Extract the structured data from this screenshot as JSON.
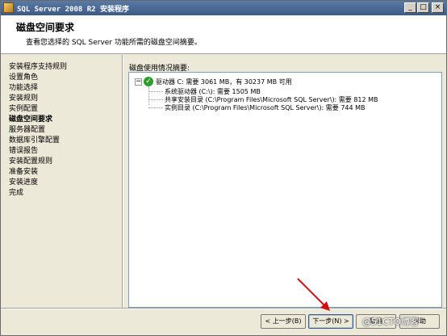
{
  "window": {
    "title": "SQL Server 2008 R2 安装程序",
    "minimize_label": "_",
    "maximize_label": "□",
    "close_label": "×"
  },
  "header": {
    "title": "磁盘空间要求",
    "description": "查看您选择的 SQL Server 功能所需的磁盘空间摘要。"
  },
  "sidebar": {
    "items": [
      {
        "label": "安装程序支持规则"
      },
      {
        "label": "设置角色"
      },
      {
        "label": "功能选择"
      },
      {
        "label": "安装规则"
      },
      {
        "label": "实例配置"
      },
      {
        "label": "磁盘空间要求",
        "active": true
      },
      {
        "label": "服务器配置"
      },
      {
        "label": "数据库引擎配置"
      },
      {
        "label": "错误报告"
      },
      {
        "label": "安装配置规则"
      },
      {
        "label": "准备安装"
      },
      {
        "label": "安装进度"
      },
      {
        "label": "完成"
      }
    ]
  },
  "main": {
    "summary_label": "磁盘使用情况摘要:",
    "tree": {
      "expander": "−",
      "root": "驱动器 C: 需要 3061 MB，有 30237 MB 可用",
      "children": [
        "系统驱动器 (C:\\): 需要 1505 MB",
        "共享安装目录 (C:\\Program Files\\Microsoft SQL Server\\): 需要 812 MB",
        "实例目录 (C:\\Program Files\\Microsoft SQL Server\\): 需要 744 MB"
      ]
    }
  },
  "footer": {
    "back_label": "< 上一步(B)",
    "next_label": "下一步(N) >",
    "cancel_label": "取消",
    "help_label": "帮助"
  },
  "watermark": "@51CTO博客",
  "colors": {
    "titlebar": "#3c5a86",
    "check": "#2e9b2e",
    "arrow": "#d01010"
  }
}
